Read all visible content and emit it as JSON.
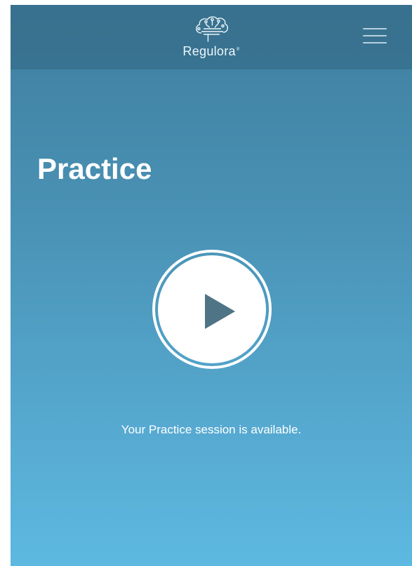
{
  "header": {
    "brand": "Regulora",
    "brand_mark": "®",
    "logo_icon": "brain-icon",
    "menu_icon": "hamburger-menu-icon"
  },
  "main": {
    "title": "Practice",
    "play_icon": "play-icon",
    "status": "Your Practice session is available."
  },
  "colors": {
    "gradient_top": "#3f7e9e",
    "gradient_bottom": "#5db9e0",
    "header_overlay": "#326682",
    "play_icon": "#4f7485",
    "text": "#ffffff"
  }
}
